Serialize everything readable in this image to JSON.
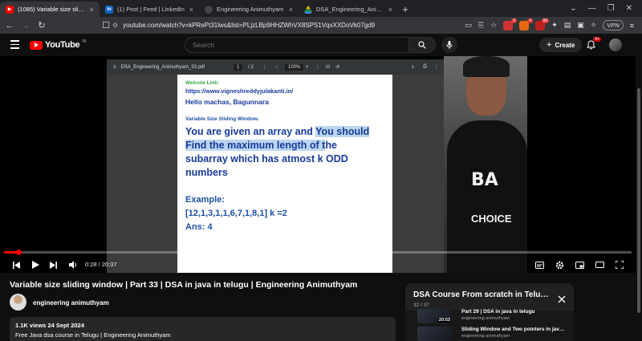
{
  "browser": {
    "tabs": [
      {
        "title": "(1085) Variable size sliding win",
        "favicon": "YT",
        "color": "#ff0000",
        "active": true
      },
      {
        "title": "(1) Post | Feed | LinkedIn",
        "favicon": "in",
        "color": "#0a66c2",
        "active": false
      },
      {
        "title": "Engineering Animuthyam",
        "favicon": "",
        "color": "#555555",
        "active": false
      },
      {
        "title": "DSA_Engineering_Animuthyam_32.p",
        "favicon": "",
        "color": "#2d8a4e",
        "active": false
      }
    ],
    "url": "youtube.com/watch?v=kPRePt31lws&list=PLjzLBp9HHZWhVX8SPS1VqxXXDoVk07gd9",
    "vpn_label": "VPN",
    "ext_badges": [
      "9",
      "4",
      "99"
    ]
  },
  "youtube": {
    "logo_text": "YouTube",
    "country_code": "IN",
    "search_placeholder": "Search",
    "create_label": "Create",
    "notification_count": "9+"
  },
  "player": {
    "pdf": {
      "filename": "DSA_Engineering_Animuthyam_33.pdf",
      "page_current": "1",
      "page_total": "/ 2",
      "zoom": "100%",
      "website_label": "Website Link:",
      "website_url": "https://www.vigneshreddyjulakanti.in/",
      "greeting": "Hello machas, Bagunnara",
      "topic": "Variable Size Sliding Window.",
      "problem_a": "You are given an array and ",
      "problem_b": "You should",
      "problem_c": "Find the maximum length of t",
      "problem_d": "he",
      "problem_e": "subarray which has atmost k ODD numbers",
      "example_label": "Example:",
      "example_array": "[12,1,3,1,1,6,7,1,8,1] k =2",
      "answer": "Ans:  4"
    },
    "webcam": {
      "shirt_line1": "BA",
      "shirt_line2": "CHOICE"
    },
    "time": "0:28 / 20:37",
    "progress_fraction": 0.023
  },
  "video": {
    "title": "Variable size sliding window | Part 33 | DSA in java in telugu | Engineering Animuthyam",
    "channel": "engineering animuthyam",
    "meta": "1.1K views  24 Sept 2024",
    "description": "Free Java dsa course in Telugu | Engineering Animuthyam"
  },
  "playlist": {
    "title": "DSA Course From scratch in Telugu in 2024",
    "position": "32 / 37",
    "items": [
      {
        "title": "Part 29 | DSA in java in telugu",
        "channel": "engineering animuthyam",
        "duration": "20:53"
      },
      {
        "title": "Sliding Window and Two pointers in java | Part 30",
        "channel": "engineering animuthyam",
        "duration": ""
      }
    ]
  }
}
